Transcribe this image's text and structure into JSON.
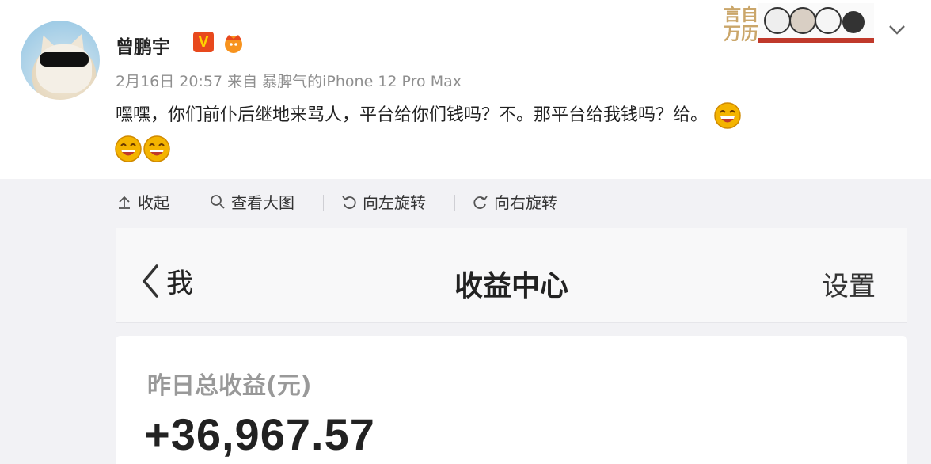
{
  "post": {
    "username": "曾鹏宇",
    "badge_v": "V",
    "meta": "2月16日 20:57 来自 暴脾气的iPhone 12 Pro Max",
    "text": "嘿嘿，你们前仆后继地来骂人，平台给你们钱吗？不。那平台给我钱吗？给。",
    "icons": {
      "avatar": "avatar-cat-sunglasses",
      "badge_crown": "crown-icon",
      "emoji": "laughing-emoji",
      "stickers": "sticker-decoration",
      "more": "chevron-down-icon"
    }
  },
  "toolbar": {
    "collapse_label": "收起",
    "view_large_label": "查看大图",
    "rotate_left_label": "向左旋转",
    "rotate_right_label": "向右旋转"
  },
  "screenshot": {
    "back_label": "我",
    "title": "收益中心",
    "settings_label": "设置",
    "card_label": "昨日总收益(元)",
    "card_value": "+36,967.57"
  },
  "colors": {
    "accent_badge": "#e8491d",
    "badge_text": "#ffd400",
    "toolbar_bg": "#f2f2f5",
    "emoji": "#f4b400"
  }
}
